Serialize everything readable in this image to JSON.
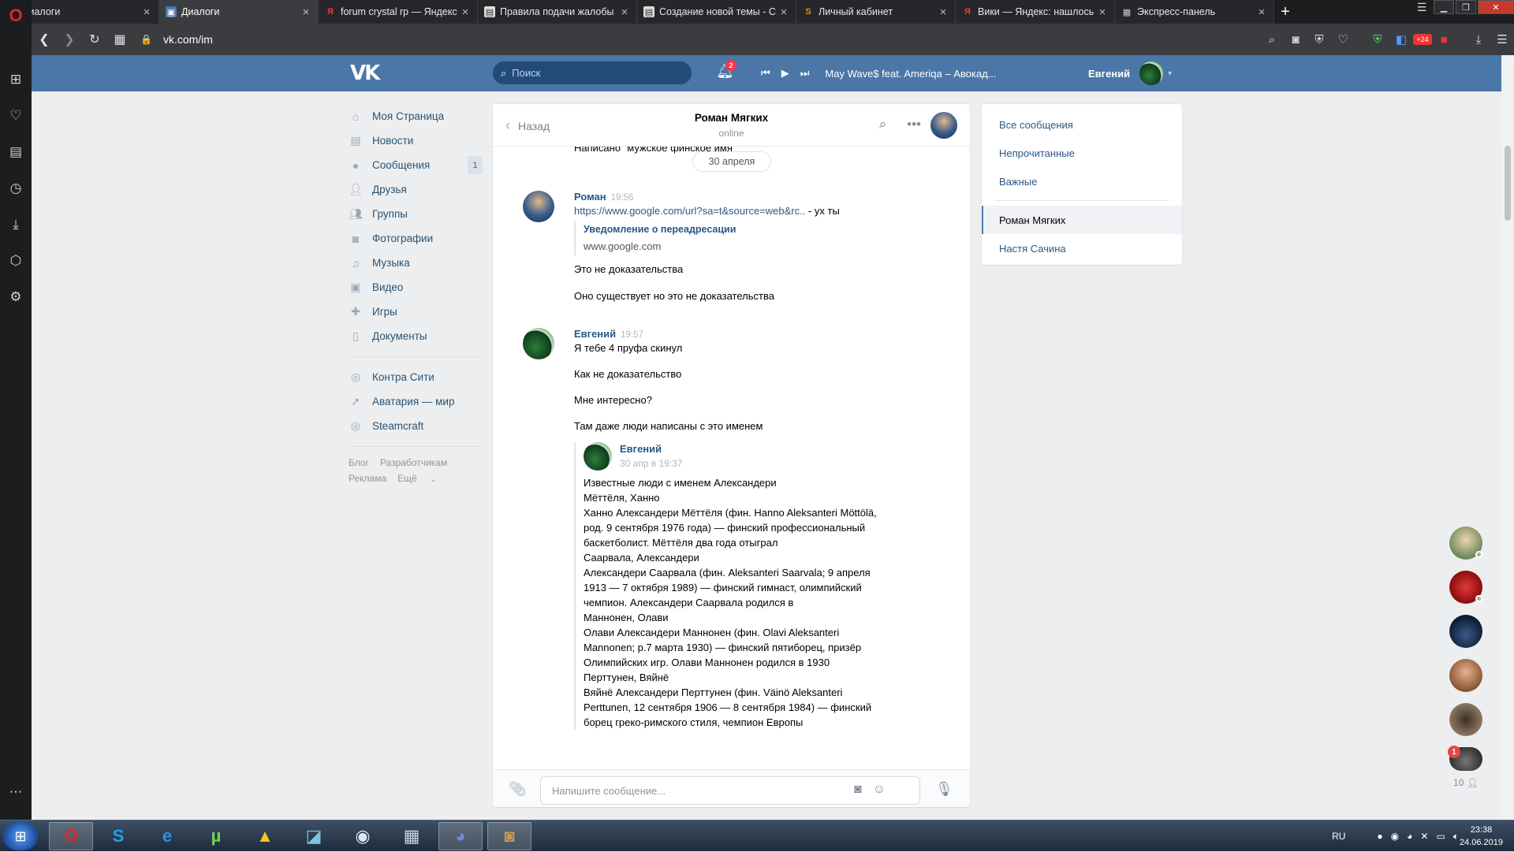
{
  "browser": {
    "tabs": [
      {
        "title": "Диалоги",
        "fav": "vk",
        "active": false
      },
      {
        "title": "Диалоги",
        "fav": "vk",
        "active": true
      },
      {
        "title": "forum crystal rp — Яндекс",
        "fav": "Я",
        "active": false
      },
      {
        "title": "Правила подачи жалобы",
        "fav": "doc",
        "active": false
      },
      {
        "title": "Создание новой темы - C",
        "fav": "doc",
        "active": false
      },
      {
        "title": "Личный кабинет",
        "fav": "S",
        "active": false
      },
      {
        "title": "Вики — Яндекс: нашлось",
        "fav": "Я",
        "active": false
      },
      {
        "title": "Экспресс-панель",
        "fav": "grid",
        "active": false
      }
    ],
    "new_tab": "+",
    "url": "vk.com/im",
    "ext_badge": "+24"
  },
  "header": {
    "logo": "VK",
    "search_placeholder": "Поиск",
    "notif_count": "2",
    "track": "May Wave$ feat. Ameriqa – Авокад...",
    "user_name": "Евгений"
  },
  "leftnav": {
    "items": [
      {
        "label": "Моя Страница",
        "icon": "home-icon"
      },
      {
        "label": "Новости",
        "icon": "news-icon"
      },
      {
        "label": "Сообщения",
        "icon": "messages-icon",
        "count": "1"
      },
      {
        "label": "Друзья",
        "icon": "friends-icon"
      },
      {
        "label": "Группы",
        "icon": "groups-icon"
      },
      {
        "label": "Фотографии",
        "icon": "photos-icon"
      },
      {
        "label": "Музыка",
        "icon": "music-icon"
      },
      {
        "label": "Видео",
        "icon": "video-icon"
      },
      {
        "label": "Игры",
        "icon": "games-icon"
      },
      {
        "label": "Документы",
        "icon": "documents-icon"
      }
    ],
    "apps": [
      {
        "label": "Контра Сити",
        "icon": "app-icon"
      },
      {
        "label": "Аватария — мир",
        "icon": "rocket-icon"
      },
      {
        "label": "Steamcraft",
        "icon": "app-icon"
      }
    ],
    "footer": [
      "Блог",
      "Разработчикам",
      "Реклама",
      "Ещё"
    ]
  },
  "chat": {
    "back": "Назад",
    "peer_name": "Роман Мягких",
    "peer_status": "online",
    "cut_text": "Написано \"мужское финское имя\"",
    "date_pill": "30 апреля",
    "msg1": {
      "author": "Роман",
      "time": "19:56",
      "link": "https://www.google.com/url?sa=t&source=web&rc..",
      "link_suffix": " - ух ты",
      "quote_title": "Уведомление о переадресации",
      "quote_sub": "www.google.com",
      "lines": [
        "Это не доказательства",
        "Оно существует но это не доказательства"
      ]
    },
    "msg2": {
      "author": "Евгений",
      "time": "19:57",
      "lines": [
        "Я тебе 4 пруфа скинул",
        "Как не доказательство",
        "Мне интересно?",
        "Там даже люди написаны с это именем"
      ]
    },
    "forward": {
      "author": "Евгений",
      "time": "30 апр в 19:37",
      "body": "Известные люди с именем Александери\nМёттёля, Ханно\nХанно Александери Мёттёля (фин. Hanno Aleksanteri Möttölä,\nрод. 9 сентября 1976 года) — финский профессиональный\nбаскетболист. Мёттёля два года отыграл\nСаарвала, Александери\nАлександери Саарвала (фин. Aleksanteri Saarvala; 9 апреля\n1913 — 7 октября 1989) — финский гимнаст, олимпийский\nчемпион. Александери Саарвала родился в\nМаннонен, Олави\nОлави Александери Маннонен (фин. Olavi Aleksanteri\nMannonen; р.7 марта 1930) — финский пятиборец, призёр\nОлимпийских игр. Олави Маннонен родился в 1930\nПерттунен, Вяйнё\nВяйнё Александери Перттунен (фин. Väinö Aleksanteri\nPerttunen, 12 сентября 1906 — 8 сентября 1984) — финский\nборец греко-римского стиля, чемпион Европы"
    },
    "composer_placeholder": "Напишите сообщение..."
  },
  "rightmenu": {
    "filters": [
      "Все сообщения",
      "Непрочитанные",
      "Важные"
    ],
    "dialogs": [
      {
        "label": "Роман Мягких",
        "selected": true
      },
      {
        "label": "Настя Сачина",
        "selected": false
      }
    ]
  },
  "friends_bar": {
    "badge": "1",
    "count": "10"
  },
  "taskbar": {
    "lang": "RU",
    "time": "23:38",
    "date": "24.06.2019"
  },
  "colors": {
    "vk_blue": "#4a76a8",
    "link": "#2a5885",
    "opera_red": "#e0262b"
  }
}
